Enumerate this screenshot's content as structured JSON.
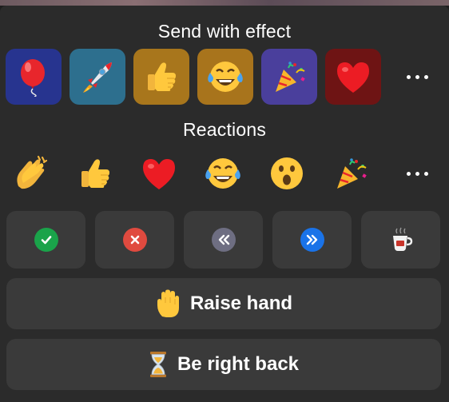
{
  "effects": {
    "title": "Send with effect",
    "items": [
      {
        "icon": "balloon-icon",
        "bg": "#27348f"
      },
      {
        "icon": "rocket-icon",
        "bg": "#2d6f8e"
      },
      {
        "icon": "thumbs-up-icon",
        "bg": "#a8761c"
      },
      {
        "icon": "tears-of-joy-icon",
        "bg": "#a8741c"
      },
      {
        "icon": "party-popper-icon",
        "bg": "#4a3f9c"
      },
      {
        "icon": "heart-icon",
        "bg": "#6e1414"
      }
    ],
    "more_icon": "more-horizontal-icon"
  },
  "reactions": {
    "title": "Reactions",
    "items": [
      {
        "icon": "clapping-hands-icon"
      },
      {
        "icon": "thumbs-up-icon"
      },
      {
        "icon": "heart-icon"
      },
      {
        "icon": "tears-of-joy-icon"
      },
      {
        "icon": "open-mouth-icon"
      },
      {
        "icon": "party-popper-icon"
      }
    ],
    "more_icon": "more-horizontal-icon"
  },
  "status_buttons": [
    {
      "icon": "yes-check-icon",
      "color": "#1aa34a"
    },
    {
      "icon": "no-x-icon",
      "color": "#e04a3f"
    },
    {
      "icon": "slow-down-icon",
      "color": "#6e6e82"
    },
    {
      "icon": "speed-up-icon",
      "color": "#1a73e8"
    },
    {
      "icon": "coffee-cup-icon",
      "color": "#ffffff"
    }
  ],
  "raise_hand": {
    "label": "Raise hand",
    "icon": "raised-hand-icon"
  },
  "be_right_back": {
    "label": "Be right back",
    "icon": "hourglass-icon"
  }
}
